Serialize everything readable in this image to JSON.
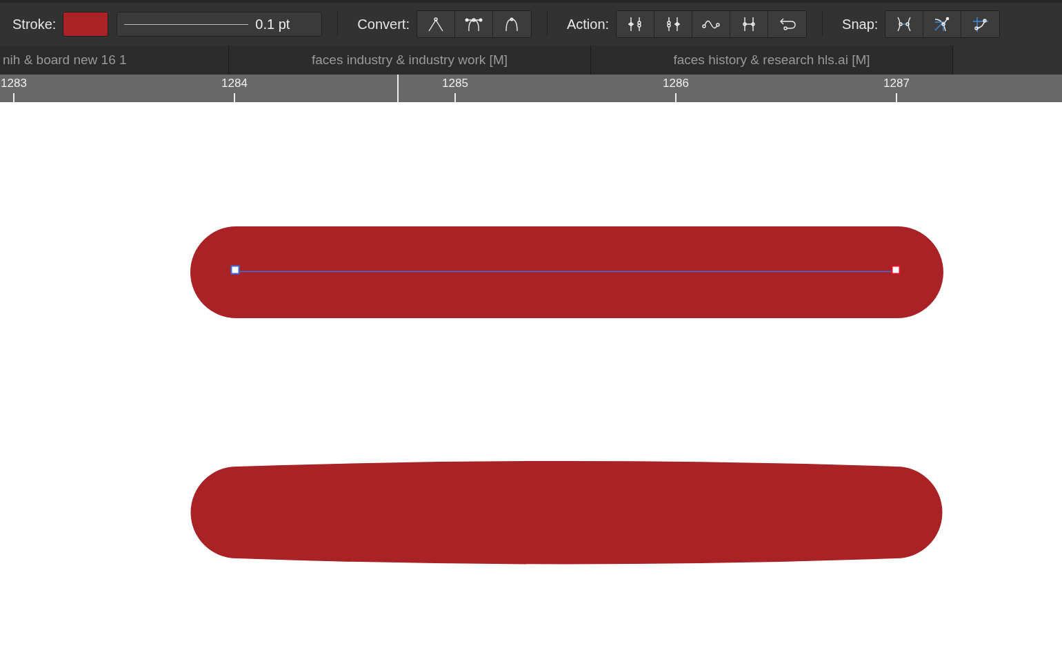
{
  "control_bar": {
    "stroke": {
      "label": "Stroke:",
      "color": "#a82226",
      "weight": "0.1 pt"
    },
    "groups": [
      {
        "label": "Convert:",
        "buttons": [
          {
            "kind": "corner"
          },
          {
            "kind": "smooth-handles"
          },
          {
            "kind": "smooth"
          }
        ]
      },
      {
        "label": "Action:",
        "buttons": [
          {
            "kind": "split-left"
          },
          {
            "kind": "split-right"
          },
          {
            "kind": "curve"
          },
          {
            "kind": "join"
          },
          {
            "kind": "reverse"
          }
        ]
      },
      {
        "label": "Snap:",
        "buttons": [
          {
            "kind": "snap-points"
          },
          {
            "kind": "snap-guides"
          },
          {
            "kind": "snap-grid"
          }
        ]
      }
    ]
  },
  "document_tabs": [
    {
      "label": "nih & board new 16 1"
    },
    {
      "label": "faces industry & industry work [M]"
    },
    {
      "label": "faces history & research hls.ai [M]"
    }
  ],
  "ruler": {
    "ticks": [
      "1283",
      "1284",
      "1285",
      "1286",
      "1287"
    ]
  }
}
